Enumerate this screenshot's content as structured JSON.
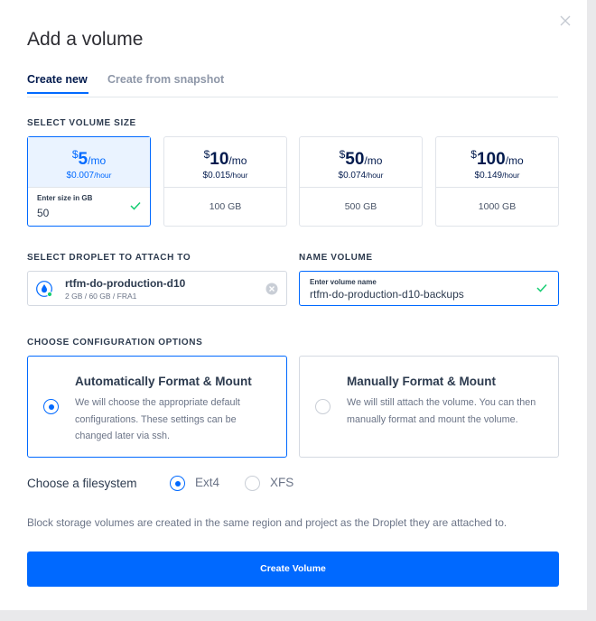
{
  "modal": {
    "title": "Add a volume"
  },
  "tabs": [
    {
      "label": "Create new",
      "active": true
    },
    {
      "label": "Create from snapshot",
      "active": false
    }
  ],
  "volume_size": {
    "section_label": "SELECT VOLUME SIZE",
    "options": [
      {
        "dollar": "$",
        "amount": "5",
        "per": "/mo",
        "hourly": "$0.007",
        "hourly_unit": "/hour",
        "size": "",
        "selected": true,
        "custom_label": "Enter size in GB",
        "custom_value": "50"
      },
      {
        "dollar": "$",
        "amount": "10",
        "per": "/mo",
        "hourly": "$0.015",
        "hourly_unit": "/hour",
        "size": "100 GB",
        "selected": false
      },
      {
        "dollar": "$",
        "amount": "50",
        "per": "/mo",
        "hourly": "$0.074",
        "hourly_unit": "/hour",
        "size": "500 GB",
        "selected": false
      },
      {
        "dollar": "$",
        "amount": "100",
        "per": "/mo",
        "hourly": "$0.149",
        "hourly_unit": "/hour",
        "size": "1000 GB",
        "selected": false
      }
    ]
  },
  "droplet": {
    "section_label": "SELECT DROPLET TO ATTACH TO",
    "name": "rtfm-do-production-d10",
    "meta": "2 GB / 60 GB / FRA1"
  },
  "name_volume": {
    "section_label": "NAME VOLUME",
    "field_label": "Enter volume name",
    "value": "rtfm-do-production-d10-backups"
  },
  "config": {
    "section_label": "CHOOSE CONFIGURATION OPTIONS",
    "options": [
      {
        "title": "Automatically Format & Mount",
        "description": "We will choose the appropriate default configurations. These settings can be changed later via ssh.",
        "selected": true
      },
      {
        "title": "Manually Format & Mount",
        "description": "We will still attach the volume. You can then manually format and mount the volume.",
        "selected": false
      }
    ]
  },
  "filesystem": {
    "label": "Choose a filesystem",
    "options": [
      {
        "label": "Ext4",
        "selected": true
      },
      {
        "label": "XFS",
        "selected": false
      }
    ]
  },
  "note": "Block storage volumes are created in the same region and project as the Droplet they are attached to.",
  "submit_label": "Create Volume",
  "colors": {
    "accent": "#0069ff",
    "success": "#15cd72",
    "text": "#031b4e",
    "muted": "#6b7487"
  },
  "icons": [
    "close-icon",
    "checkmark-icon",
    "droplet-icon",
    "clear-icon"
  ]
}
